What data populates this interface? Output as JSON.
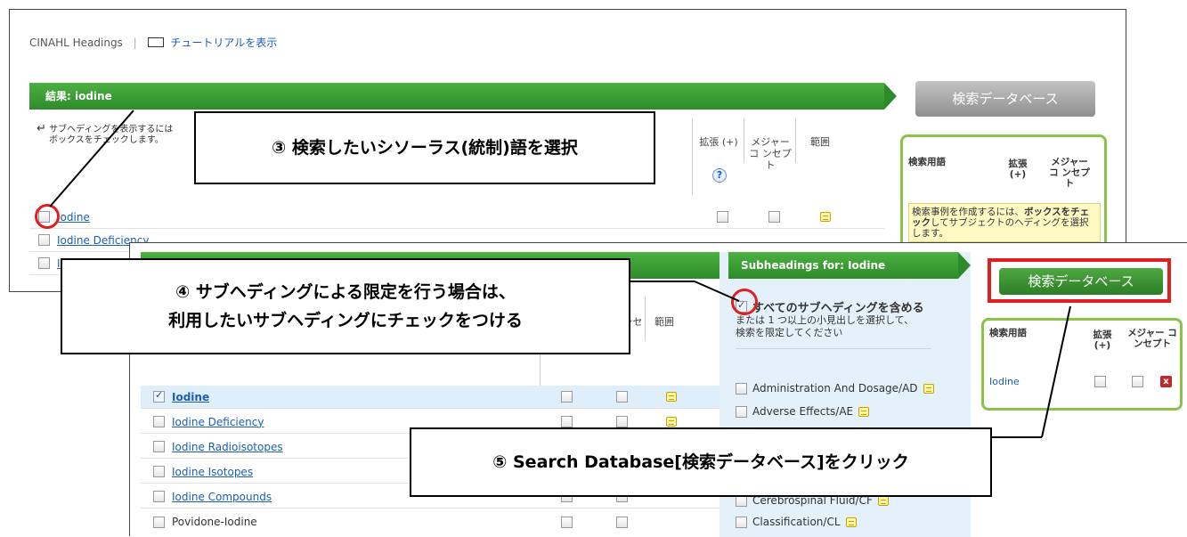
{
  "window1": {
    "app_title": "CINAHL Headings",
    "tutorial_link": "チュートリアルを表示",
    "results_title": "結果: iodine",
    "instruction_line1": "サブヘディングを表示するには",
    "instruction_line2": "ボックスをチェックします。",
    "col_explode": "拡張 (+)",
    "col_major": "メジャー コ ンセプト",
    "col_scope": "範囲",
    "help_label": "?",
    "rows": [
      "Iodine",
      "Iodine Deficiency",
      "I"
    ],
    "search_button": "検索データベース",
    "terms_header": "検索用語",
    "terms_explode": "拡張 (+)",
    "terms_major": "メジャー コ ンセプト",
    "hint_text_a": "検索事例を作成するには、",
    "hint_text_b": "ボックスをチェック",
    "hint_text_c": "してサブジェクトのヘディングを選択します。"
  },
  "window2": {
    "col_major_partial": "ー コ ンセプト",
    "col_scope": "範囲",
    "rows": [
      "Iodine",
      "Iodine Deficiency",
      "Iodine Radioisotopes",
      "Iodine Isotopes",
      "Iodine Compounds",
      "Povidone-Iodine"
    ],
    "subheadings_title": "Subheadings for: Iodine",
    "include_all": "すべてのサブヘディングを含める",
    "include_all_sub1": "または 1 つ以上の小見出しを選択して、",
    "include_all_sub2": "検索を限定してください",
    "subheadings": [
      "Administration And Dosage/AD",
      "Adverse Effects/AE",
      "Cerebrospinal Fluid/CF",
      "Classification/CL"
    ],
    "search_button": "検索データベース",
    "terms_header": "検索用語",
    "terms_explode": "拡張 (+)",
    "terms_major": "メジャー コ ンセプト",
    "selected_term": "Iodine"
  },
  "callouts": {
    "step3": "③ 検索したいシソーラス(統制)語を選択",
    "step4_line1": "④ サブヘディングによる限定を行う場合は、",
    "step4_line2": "利用したいサブヘディングにチェックをつける",
    "step5": "⑤ Search Database[検索データベース]をクリック"
  },
  "colors": {
    "accent_green": "#2e8b2a",
    "callout_red": "#e02020",
    "link_blue": "#1a5fb4"
  }
}
